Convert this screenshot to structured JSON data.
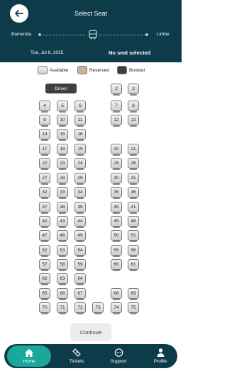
{
  "header": {
    "title": "Select Seat",
    "from": "Bamenda",
    "to": "Limbe",
    "date": "Tue, Jul 8, 2025",
    "selection_status": "No seat selected"
  },
  "legend": {
    "available": "Available",
    "reserved": "Reserved",
    "booked": "Booked"
  },
  "colors": {
    "header_bg": "#0e3b4a",
    "nav_active": "#1aa89a",
    "reserved": "#cbb296",
    "booked": "#3f3f3f"
  },
  "driver_label": "Driver",
  "seats": [
    "2",
    "3",
    "4",
    "5",
    "6",
    "7",
    "8",
    "9",
    "10",
    "11",
    "12",
    "13",
    "14",
    "15",
    "16",
    "17",
    "18",
    "19",
    "20",
    "21",
    "22",
    "23",
    "24",
    "25",
    "26",
    "27",
    "28",
    "29",
    "30",
    "31",
    "32",
    "33",
    "34",
    "35",
    "36",
    "37",
    "38",
    "39",
    "40",
    "41",
    "42",
    "43",
    "44",
    "45",
    "46",
    "47",
    "48",
    "49",
    "50",
    "51",
    "52",
    "53",
    "54",
    "55",
    "56",
    "57",
    "58",
    "59",
    "60",
    "61",
    "62",
    "63",
    "64",
    "65",
    "66",
    "67",
    "68",
    "69",
    "70",
    "71",
    "72",
    "73",
    "74",
    "75"
  ],
  "continue_label": "Continue",
  "nav": {
    "home": "Home",
    "tickets": "Tickets",
    "support": "Support",
    "profile": "Profile"
  }
}
